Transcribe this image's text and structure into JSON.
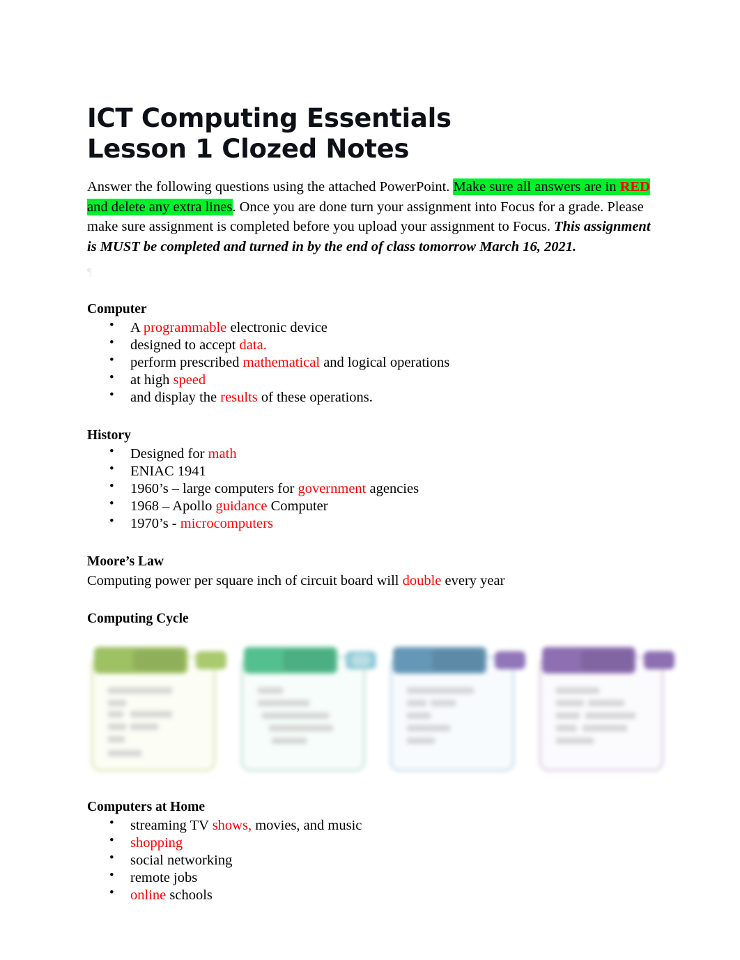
{
  "document": {
    "title_lines": [
      "ICT Computing Essentials",
      "Lesson 1 Clozed Notes"
    ],
    "colors": {
      "answer_red": "#FF0000",
      "highlight_green": "#00FF00",
      "text_black": "#000000",
      "card_green_olive": "#9BBF5E",
      "card_green_teal": "#4FBE8C",
      "card_blue": "#6195B5",
      "card_purple": "#8A6BB0"
    },
    "intro": {
      "seg_1": "Answer the following questions using the attached PowerPoint. ",
      "seg_2_highlighted_pre": "Make sure all answers are in ",
      "seg_3_highlighted_red": "RED",
      "seg_4_highlighted_post": " and delete any extra lines",
      "seg_5": ". Once you are done turn your assignment into Focus for a grade. Please make sure assignment is completed before you upload your assignment to Focus. ",
      "seg_6_bold_italic": "This assignment is MUST be completed and turned in by the end of class tomorrow March 16, 2021."
    },
    "sections": [
      {
        "heading": "Computer",
        "type": "bullets",
        "items": [
          {
            "pre": "A ",
            "answer": "programmable",
            "post": " electronic device"
          },
          {
            "pre": "designed to accept ",
            "answer": "data.",
            "post": ""
          },
          {
            "pre": "perform prescribed ",
            "answer": "mathematical",
            "post": " and logical operations"
          },
          {
            "pre": "at high ",
            "answer": "speed",
            "post": ""
          },
          {
            "pre": "and display the ",
            "answer": "results",
            "post": " of these operations."
          }
        ]
      },
      {
        "heading": "History",
        "type": "bullets",
        "items": [
          {
            "pre": "Designed for ",
            "answer": "math",
            "post": ""
          },
          {
            "pre": "ENIAC 1941",
            "answer": "",
            "post": ""
          },
          {
            "pre": "1960’s – large computers for ",
            "answer": "government",
            "post": " agencies"
          },
          {
            "pre": "1968 – Apollo ",
            "answer": "guidance",
            "post": " Computer"
          },
          {
            "pre": "1970’s - ",
            "answer": "microcomputers",
            "post": ""
          }
        ]
      },
      {
        "heading": "Moore’s Law",
        "type": "paragraph",
        "line": {
          "pre": "Computing power per square inch of circuit board will ",
          "answer": "double",
          "post": " every year"
        }
      },
      {
        "heading": "Computing Cycle",
        "type": "figure",
        "figure": {
          "kind": "four-stage-cycle-diagram",
          "blurred": true,
          "cards": [
            {
              "header_color": "#9BBF5E",
              "tab_color": "#A7C969"
            },
            {
              "header_color": "#4FBE8C",
              "tab_color": "#8FC9D6"
            },
            {
              "header_color": "#6195B5",
              "tab_color": "#8E72B8"
            },
            {
              "header_color": "#8A6BB0",
              "tab_color": "#8A6BB0"
            }
          ]
        }
      },
      {
        "heading": "Computers at Home",
        "type": "bullets",
        "items": [
          {
            "pre": "streaming TV ",
            "answer": "shows,",
            "post": "  movies, and music"
          },
          {
            "pre": "",
            "answer": "shopping",
            "post": ""
          },
          {
            "pre": "social networking",
            "answer": "",
            "post": ""
          },
          {
            "pre": "remote jobs",
            "answer": "",
            "post": ""
          },
          {
            "pre": "",
            "answer": "online",
            "post": "  schools"
          }
        ]
      }
    ]
  }
}
